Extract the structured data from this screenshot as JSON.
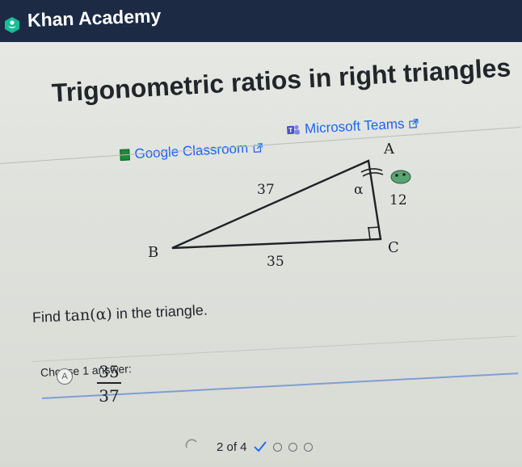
{
  "header": {
    "brand": "Khan Academy"
  },
  "page": {
    "title": "Trigonometric ratios in right triangles",
    "share": {
      "google_classroom": "Google Classroom",
      "microsoft_teams": "Microsoft Teams"
    }
  },
  "figure": {
    "vertices": {
      "a": "A",
      "b": "B",
      "c": "C"
    },
    "angle_label": "α",
    "sides": {
      "hypotenuse": "37",
      "vertical": "12",
      "horizontal": "35"
    }
  },
  "question": {
    "prefix": "Find",
    "expression": "tan(α)",
    "suffix": "in the triangle.",
    "choose_label": "Choose 1 answer:"
  },
  "choices": [
    {
      "letter": "A",
      "numerator": "35",
      "denominator": "37"
    }
  ],
  "progress": {
    "text": "2 of 4"
  },
  "colors": {
    "topbar": "#1d2a44",
    "link": "#1865f2",
    "accent": "#1865f2"
  }
}
